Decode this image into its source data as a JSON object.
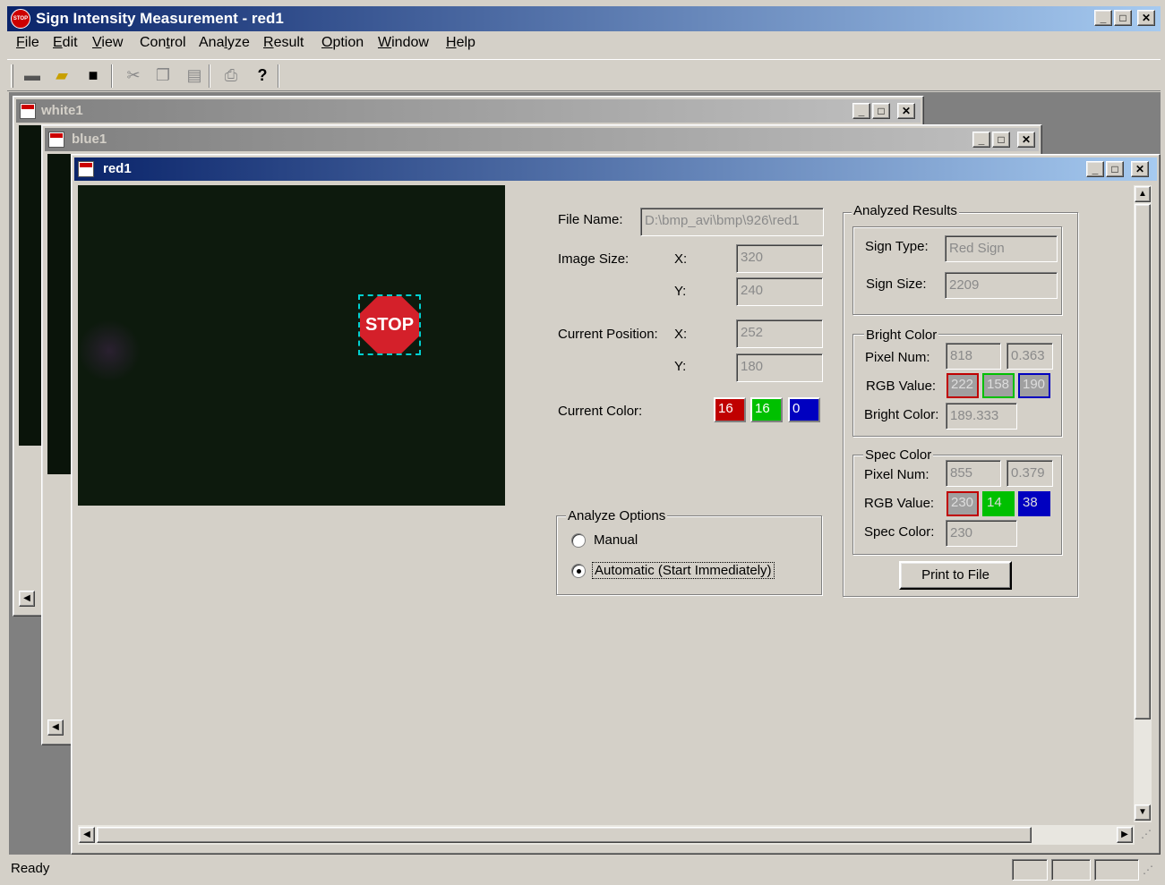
{
  "app": {
    "title": "Sign Intensity Measurement - red1",
    "status": "Ready",
    "logo_text": "STOP"
  },
  "menu": [
    {
      "key": "F",
      "rest": "ile"
    },
    {
      "key": "E",
      "rest": "dit"
    },
    {
      "key": "V",
      "rest": "iew"
    },
    {
      "key": "",
      "rest": "Control",
      "pre": "Con",
      "k2": "t",
      "post": "rol"
    },
    {
      "key": "",
      "pre": "Ana",
      "k2": "l",
      "post": "yze"
    },
    {
      "key": "R",
      "rest": "esult"
    },
    {
      "key": "O",
      "rest": "ption"
    },
    {
      "key": "W",
      "rest": "indow"
    },
    {
      "key": "H",
      "rest": "elp"
    }
  ],
  "menu_labels": {
    "file_k": "F",
    "file_r": "ile",
    "edit_k": "E",
    "edit_r": "dit",
    "view_k": "V",
    "view_r": "iew",
    "control_a": "Con",
    "control_k": "t",
    "control_b": "rol",
    "analyze_a": "Ana",
    "analyze_k": "l",
    "analyze_b": "yze",
    "result_k": "R",
    "result_r": "esult",
    "option_k": "O",
    "option_r": "ption",
    "window_k": "W",
    "window_r": "indow",
    "help_k": "H",
    "help_r": "elp"
  },
  "windows": {
    "white": "white1",
    "blue": "blue1",
    "red": "red1"
  },
  "image": {
    "sign_text": "STOP"
  },
  "form": {
    "file_name_label": "File Name:",
    "file_name_value": "D:\\bmp_avi\\bmp\\926\\red1",
    "image_size_label": "Image Size:",
    "x_label": "X:",
    "y_label": "Y:",
    "image_x": "320",
    "image_y": "240",
    "current_position_label": "Current Position:",
    "pos_x": "252",
    "pos_y": "180",
    "current_color_label": "Current Color:",
    "cur_r": "16",
    "cur_g": "16",
    "cur_b": "0"
  },
  "analyze_options": {
    "title": "Analyze Options",
    "manual": "Manual",
    "automatic": "Automatic (Start Immediately)",
    "selected": "automatic"
  },
  "results": {
    "title": "Analyzed Results",
    "sign_type_label": "Sign Type:",
    "sign_type": "Red Sign",
    "sign_size_label": "Sign Size:",
    "sign_size": "2209",
    "bright": {
      "title": "Bright Color",
      "pixel_label": "Pixel Num:",
      "pixel_num": "818",
      "ratio": "0.363",
      "rgb_label": "RGB Value:",
      "r": "222",
      "g": "158",
      "b": "190",
      "color_label": "Bright Color:",
      "color": "189.333"
    },
    "spec": {
      "title": "Spec Color",
      "pixel_label": "Pixel Num:",
      "pixel_num": "855",
      "ratio": "0.379",
      "rgb_label": "RGB Value:",
      "r": "230",
      "g": "14",
      "b": "38",
      "color_label": "Spec Color:",
      "color": "230"
    },
    "print_button": "Print to File"
  },
  "colors": {
    "titlebar_start": "#0a246a",
    "titlebar_end": "#a6caf0",
    "face": "#d4d0c8",
    "red": "#c00000",
    "green": "#00c000",
    "blue": "#0000c0"
  }
}
